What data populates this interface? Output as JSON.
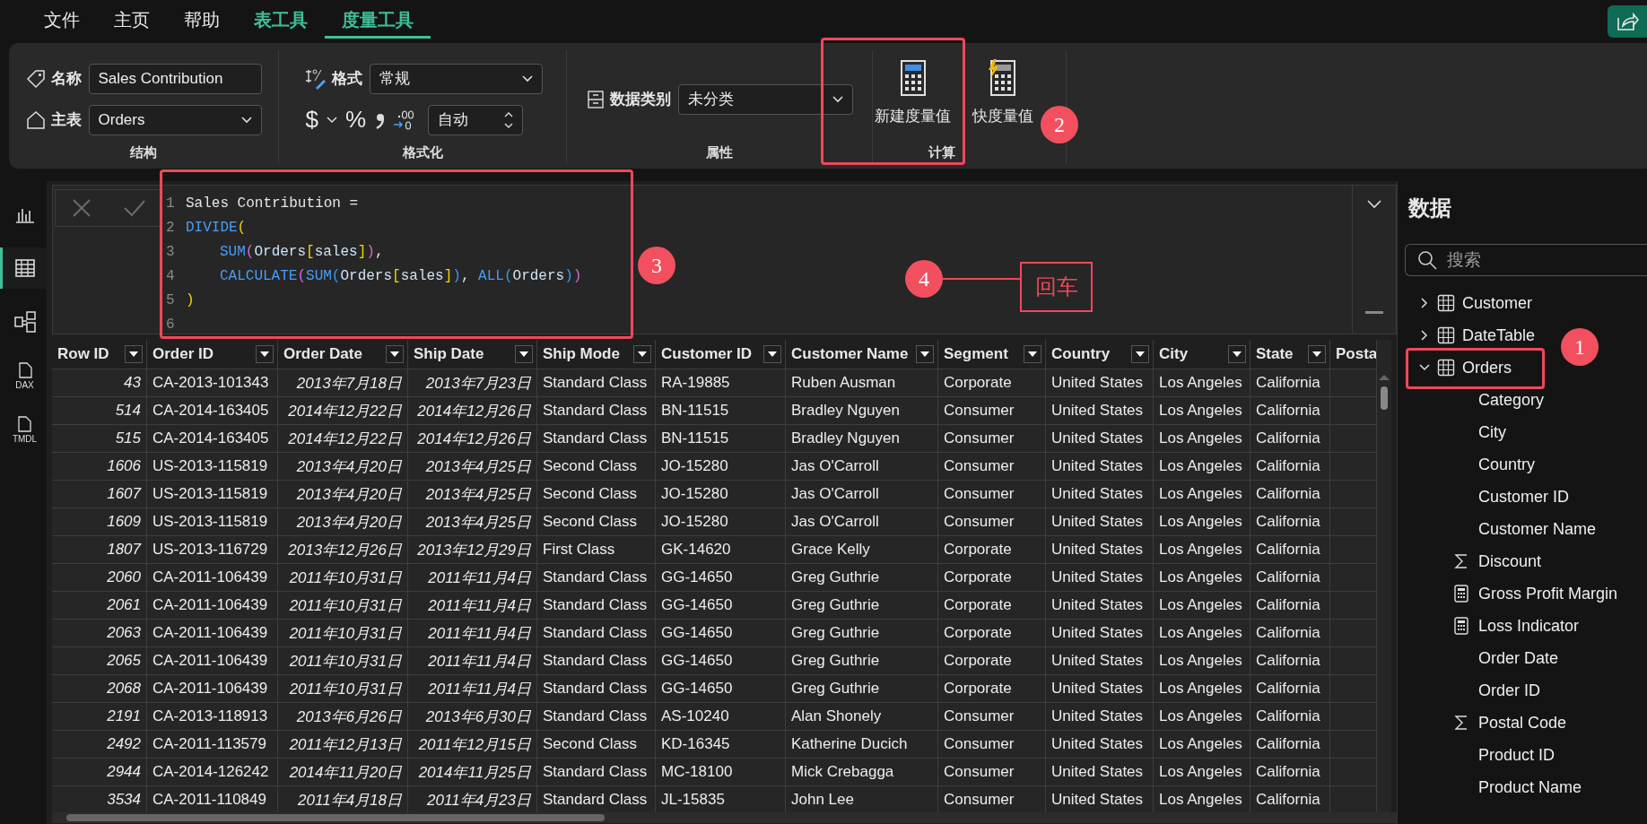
{
  "menu_tabs": [
    {
      "label": "文件",
      "kind": "plain",
      "selected": false
    },
    {
      "label": "主页",
      "kind": "plain",
      "selected": false
    },
    {
      "label": "帮助",
      "kind": "plain",
      "selected": false
    },
    {
      "label": "表工具",
      "kind": "tool",
      "selected": false
    },
    {
      "label": "度量工具",
      "kind": "tool",
      "selected": true
    }
  ],
  "ribbon": {
    "structure": {
      "group_label": "结构",
      "name_label": "名称",
      "name_value": "Sales Contribution",
      "home_table_label": "主表",
      "home_table_value": "Orders"
    },
    "formatting": {
      "group_label": "格式化",
      "format_label": "格式",
      "format_value": "常规",
      "currency": "$",
      "percent": "%",
      "decimals_value": "自动"
    },
    "properties": {
      "group_label": "属性",
      "data_category_label": "数据类别",
      "data_category_value": "未分类"
    },
    "calculations": {
      "group_label": "计算",
      "buttons": [
        {
          "label": "新建度量值"
        },
        {
          "label": "快度量值"
        }
      ]
    }
  },
  "rail": [
    {
      "kind": "report",
      "selected": false
    },
    {
      "kind": "table",
      "selected": true
    },
    {
      "kind": "model",
      "selected": false
    },
    {
      "kind": "file",
      "label": "DAX",
      "selected": false
    },
    {
      "kind": "file",
      "label": "TMDL",
      "selected": false
    }
  ],
  "formula": {
    "lines": [
      {
        "number": "1",
        "indented": false,
        "tokens": [
          {
            "kind": "text",
            "text": "Sales Contribution ="
          }
        ]
      },
      {
        "number": "2",
        "indented": false,
        "tokens": [
          {
            "kind": "fn",
            "text": "DIVIDE"
          },
          {
            "kind": "b1",
            "text": "("
          }
        ]
      },
      {
        "number": "3",
        "indented": true,
        "tokens": [
          {
            "kind": "fn",
            "text": "SUM"
          },
          {
            "kind": "b2",
            "text": "("
          },
          {
            "kind": "name",
            "text": "Orders"
          },
          {
            "kind": "b1",
            "text": "["
          },
          {
            "kind": "name",
            "text": "sales"
          },
          {
            "kind": "b1",
            "text": "]"
          },
          {
            "kind": "b2",
            "text": ")"
          },
          {
            "kind": "text",
            "text": ","
          }
        ]
      },
      {
        "number": "4",
        "indented": true,
        "tokens": [
          {
            "kind": "fn",
            "text": "CALCULATE"
          },
          {
            "kind": "b2",
            "text": "("
          },
          {
            "kind": "fn",
            "text": "SUM"
          },
          {
            "kind": "b3",
            "text": "("
          },
          {
            "kind": "name",
            "text": "Orders"
          },
          {
            "kind": "b1",
            "text": "["
          },
          {
            "kind": "name",
            "text": "sales"
          },
          {
            "kind": "b1",
            "text": "]"
          },
          {
            "kind": "b3",
            "text": ")"
          },
          {
            "kind": "text",
            "text": ", "
          },
          {
            "kind": "fn",
            "text": "ALL"
          },
          {
            "kind": "b3",
            "text": "("
          },
          {
            "kind": "name",
            "text": "Orders"
          },
          {
            "kind": "b3",
            "text": ")"
          },
          {
            "kind": "b2",
            "text": ")"
          }
        ]
      },
      {
        "number": "5",
        "indented": false,
        "tokens": [
          {
            "kind": "b1",
            "text": ")"
          }
        ]
      },
      {
        "number": "6"
      }
    ]
  },
  "table": {
    "columns": [
      {
        "label": "Row ID",
        "kind": "number"
      },
      {
        "label": "Order ID",
        "kind": "text"
      },
      {
        "label": "Order Date",
        "kind": "date"
      },
      {
        "label": "Ship Date",
        "kind": "date"
      },
      {
        "label": "Ship Mode",
        "kind": "text"
      },
      {
        "label": "Customer ID",
        "kind": "text"
      },
      {
        "label": "Customer Name",
        "kind": "text"
      },
      {
        "label": "Segment",
        "kind": "text"
      },
      {
        "label": "Country",
        "kind": "text"
      },
      {
        "label": "City",
        "kind": "text"
      },
      {
        "label": "State",
        "kind": "text"
      },
      {
        "label": "Posta",
        "kind": "cut"
      }
    ],
    "rows": [
      [
        "43",
        "CA-2013-101343",
        "2013年7月18日",
        "2013年7月23日",
        "Standard Class",
        "RA-19885",
        "Ruben Ausman",
        "Corporate",
        "United States",
        "Los Angeles",
        "California"
      ],
      [
        "514",
        "CA-2014-163405",
        "2014年12月22日",
        "2014年12月26日",
        "Standard Class",
        "BN-11515",
        "Bradley Nguyen",
        "Consumer",
        "United States",
        "Los Angeles",
        "California"
      ],
      [
        "515",
        "CA-2014-163405",
        "2014年12月22日",
        "2014年12月26日",
        "Standard Class",
        "BN-11515",
        "Bradley Nguyen",
        "Consumer",
        "United States",
        "Los Angeles",
        "California"
      ],
      [
        "1606",
        "US-2013-115819",
        "2013年4月20日",
        "2013年4月25日",
        "Second Class",
        "JO-15280",
        "Jas O'Carroll",
        "Consumer",
        "United States",
        "Los Angeles",
        "California"
      ],
      [
        "1607",
        "US-2013-115819",
        "2013年4月20日",
        "2013年4月25日",
        "Second Class",
        "JO-15280",
        "Jas O'Carroll",
        "Consumer",
        "United States",
        "Los Angeles",
        "California"
      ],
      [
        "1609",
        "US-2013-115819",
        "2013年4月20日",
        "2013年4月25日",
        "Second Class",
        "JO-15280",
        "Jas O'Carroll",
        "Consumer",
        "United States",
        "Los Angeles",
        "California"
      ],
      [
        "1807",
        "US-2013-116729",
        "2013年12月26日",
        "2013年12月29日",
        "First Class",
        "GK-14620",
        "Grace Kelly",
        "Corporate",
        "United States",
        "Los Angeles",
        "California"
      ],
      [
        "2060",
        "CA-2011-106439",
        "2011年10月31日",
        "2011年11月4日",
        "Standard Class",
        "GG-14650",
        "Greg Guthrie",
        "Corporate",
        "United States",
        "Los Angeles",
        "California"
      ],
      [
        "2061",
        "CA-2011-106439",
        "2011年10月31日",
        "2011年11月4日",
        "Standard Class",
        "GG-14650",
        "Greg Guthrie",
        "Corporate",
        "United States",
        "Los Angeles",
        "California"
      ],
      [
        "2063",
        "CA-2011-106439",
        "2011年10月31日",
        "2011年11月4日",
        "Standard Class",
        "GG-14650",
        "Greg Guthrie",
        "Corporate",
        "United States",
        "Los Angeles",
        "California"
      ],
      [
        "2065",
        "CA-2011-106439",
        "2011年10月31日",
        "2011年11月4日",
        "Standard Class",
        "GG-14650",
        "Greg Guthrie",
        "Corporate",
        "United States",
        "Los Angeles",
        "California"
      ],
      [
        "2068",
        "CA-2011-106439",
        "2011年10月31日",
        "2011年11月4日",
        "Standard Class",
        "GG-14650",
        "Greg Guthrie",
        "Corporate",
        "United States",
        "Los Angeles",
        "California"
      ],
      [
        "2191",
        "CA-2013-118913",
        "2013年6月26日",
        "2013年6月30日",
        "Standard Class",
        "AS-10240",
        "Alan Shonely",
        "Consumer",
        "United States",
        "Los Angeles",
        "California"
      ],
      [
        "2492",
        "CA-2011-113579",
        "2011年12月13日",
        "2011年12月15日",
        "Second Class",
        "KD-16345",
        "Katherine Ducich",
        "Consumer",
        "United States",
        "Los Angeles",
        "California"
      ],
      [
        "2944",
        "CA-2014-126242",
        "2014年11月20日",
        "2014年11月25日",
        "Standard Class",
        "MC-18100",
        "Mick Crebagga",
        "Consumer",
        "United States",
        "Los Angeles",
        "California"
      ],
      [
        "3534",
        "CA-2011-110849",
        "2011年4月18日",
        "2011年4月23日",
        "Standard Class",
        "JL-15835",
        "John Lee",
        "Consumer",
        "United States",
        "Los Angeles",
        "California"
      ]
    ]
  },
  "data_pane": {
    "title": "数据",
    "search": {
      "placeholder": "搜索"
    },
    "tree": [
      {
        "label": "Customer",
        "kind": "table",
        "expanded": false
      },
      {
        "label": "DateTable",
        "kind": "table",
        "expanded": false
      },
      {
        "label": "Orders",
        "kind": "table",
        "expanded": true,
        "children": [
          {
            "label": "Category",
            "kind": "field"
          },
          {
            "label": "City",
            "kind": "field"
          },
          {
            "label": "Country",
            "kind": "field"
          },
          {
            "label": "Customer ID",
            "kind": "field"
          },
          {
            "label": "Customer Name",
            "kind": "field"
          },
          {
            "label": "Discount",
            "kind": "sum"
          },
          {
            "label": "Gross Profit Margin",
            "kind": "measure"
          },
          {
            "label": "Loss Indicator",
            "kind": "measure"
          },
          {
            "label": "Order Date",
            "kind": "field"
          },
          {
            "label": "Order ID",
            "kind": "field"
          },
          {
            "label": "Postal Code",
            "kind": "sum"
          },
          {
            "label": "Product ID",
            "kind": "field"
          },
          {
            "label": "Product Name",
            "kind": "field"
          }
        ]
      }
    ]
  },
  "annotations": [
    {
      "kind": "frame"
    },
    {
      "kind": "marker",
      "label": "1"
    },
    {
      "kind": "frame"
    },
    {
      "kind": "marker",
      "label": "2"
    },
    {
      "kind": "frame"
    },
    {
      "kind": "marker",
      "label": "3"
    },
    {
      "kind": "marker",
      "label": "4"
    },
    {
      "kind": "leader"
    },
    {
      "kind": "callout",
      "label": "回车"
    }
  ]
}
